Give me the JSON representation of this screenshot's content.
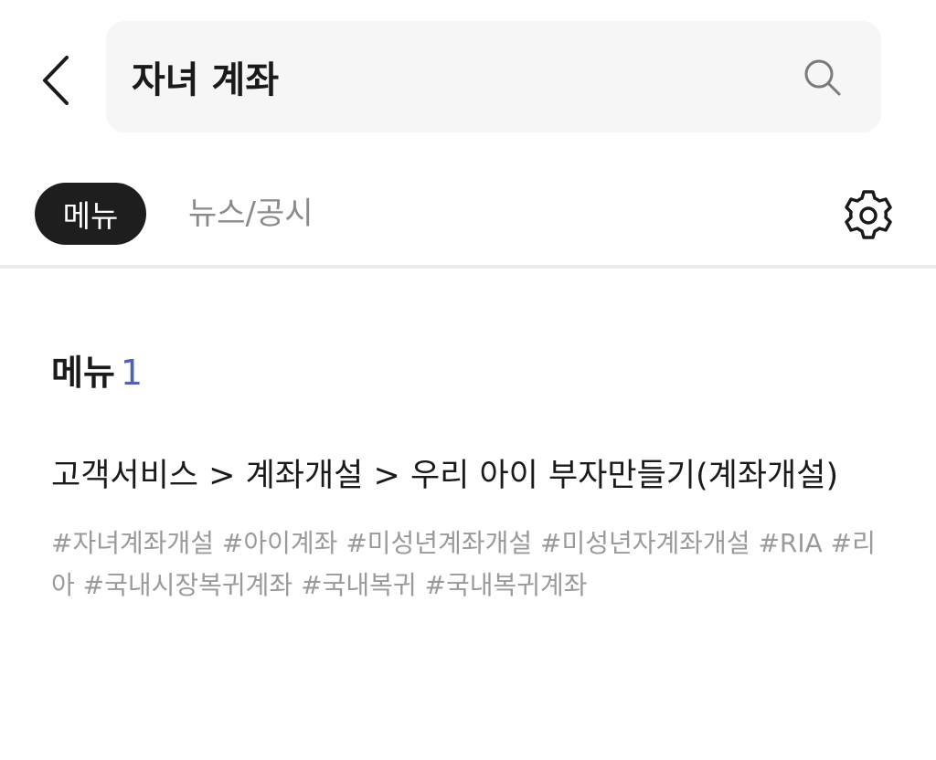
{
  "search": {
    "query": "자녀 계좌"
  },
  "tabs": [
    {
      "label": "메뉴"
    },
    {
      "label": "뉴스/공시"
    }
  ],
  "results": {
    "section_label": "메뉴",
    "count": "1",
    "items": [
      {
        "path": "고객서비스 > 계좌개설 > 우리 아이 부자만들기(계좌개설)",
        "tags": "#자녀계좌개설 #아이계좌 #미성년계좌개설 #미성년자계좌개설 #RIA #리아 #국내시장복귀계좌 #국내복귀 #국내복귀계좌"
      }
    ]
  },
  "icons": {
    "back": "chevron-left-icon",
    "search": "search-icon",
    "settings": "gear-icon"
  },
  "colors": {
    "active_tab_bg": "#1e1e1e",
    "count_accent": "#4f63b0",
    "search_bg": "#f6f6f6"
  }
}
